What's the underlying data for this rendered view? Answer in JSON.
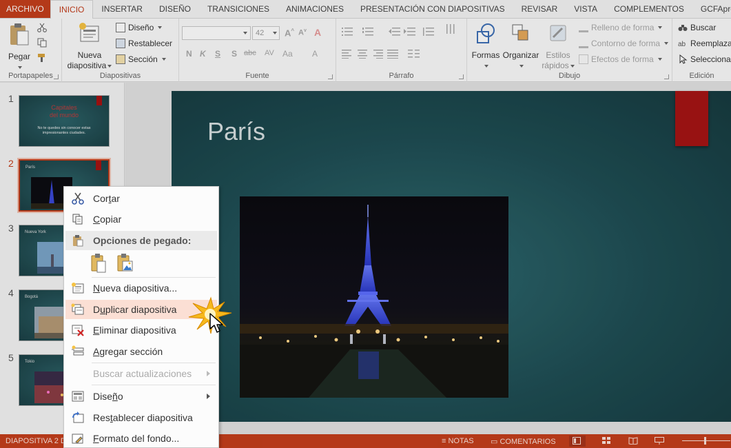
{
  "tabs": [
    "ARCHIVO",
    "INICIO",
    "INSERTAR",
    "DISEÑO",
    "TRANSICIONES",
    "ANIMACIONES",
    "PRESENTACIÓN CON DIAPOSITIVAS",
    "REVISAR",
    "VISTA",
    "COMPLEMENTOS",
    "GCFAprendeLi"
  ],
  "ribbon": {
    "portapapeles": {
      "paste": "Pegar",
      "label": "Portapapeles"
    },
    "diapositivas": {
      "new_line1": "Nueva",
      "new_line2": "diapositiva",
      "diseno": "Diseño",
      "restablecer": "Restablecer",
      "seccion": "Sección",
      "label": "Diapositivas"
    },
    "fuente": {
      "size": "42",
      "label": "Fuente",
      "bold": "N",
      "italic": "K",
      "underline": "S",
      "shadow": "S",
      "strike": "abc",
      "spacing": "AV",
      "case": "Aa",
      "color": "A"
    },
    "parrafo": {
      "label": "Párrafo"
    },
    "dibujo": {
      "formas": "Formas",
      "organizar": "Organizar",
      "estilos_line1": "Estilos",
      "estilos_line2": "rápidos",
      "relleno": "Relleno de forma",
      "contorno": "Contorno de forma",
      "efectos": "Efectos de forma",
      "label": "Dibujo"
    },
    "edicion": {
      "buscar": "Buscar",
      "reemplazar": "Reemplaza",
      "seleccionar": "Selecciona",
      "label": "Edición"
    }
  },
  "thumbnails": [
    {
      "num": "1",
      "title_line1": "Capitales",
      "title_line2": "del mundo",
      "sub": "No te quedes sin conocer estas impresionantes ciudades."
    },
    {
      "num": "2",
      "title": "París"
    },
    {
      "num": "3",
      "title": "Nueva York"
    },
    {
      "num": "4",
      "title": "Bogotá"
    },
    {
      "num": "5",
      "title": "Tokio"
    }
  ],
  "slide": {
    "title": "París"
  },
  "context_menu": {
    "cortar": {
      "pre": "Cor",
      "u": "t",
      "post": "ar"
    },
    "copiar": {
      "pre": "",
      "u": "C",
      "post": "opiar"
    },
    "paste_header": "Opciones de pegado:",
    "nueva": {
      "pre": "",
      "u": "N",
      "post": "ueva diapositiva..."
    },
    "duplicar": {
      "pre": "D",
      "u": "u",
      "post": "plicar diapositiva"
    },
    "eliminar": {
      "pre": "",
      "u": "E",
      "post": "liminar diapositiva"
    },
    "agregar": {
      "pre": "",
      "u": "A",
      "post": "gregar sección"
    },
    "buscar": "Buscar actualizaciones",
    "diseno": {
      "pre": "Dise",
      "u": "ñ",
      "post": "o"
    },
    "restablecer": {
      "pre": "Res",
      "u": "t",
      "post": "ablecer diapositiva"
    },
    "formato": {
      "pre": "",
      "u": "F",
      "post": "ormato del fondo..."
    }
  },
  "status": {
    "slide_info": "DIAPOSITIVA 2 D",
    "notas": "NOTAS",
    "comentarios": "COMENTARIOS"
  },
  "colors": {
    "accent": "#c43e1c",
    "highlight": "#fbdfd4",
    "slide_bg": "#1e4c52",
    "red_bar": "#a51414"
  }
}
